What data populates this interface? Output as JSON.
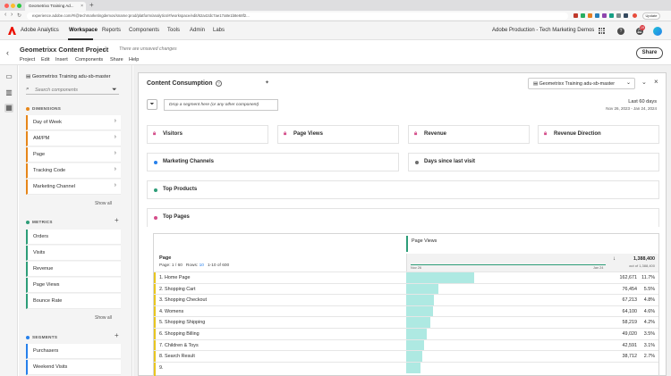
{
  "browser": {
    "tab_title": "Geometrixx Training Ad...",
    "url": "experience.adobe.com/#/@techmarketingdemos/sname:prod/platform/analytics/#/workspace/edit/62a42dc7ae17a8e1b8e68f2...",
    "update_label": "Update"
  },
  "appnav": {
    "app_name": "Adobe Analytics",
    "items": [
      "Workspace",
      "Reports",
      "Components",
      "Tools",
      "Admin",
      "Labs"
    ],
    "org_name": "Adobe Production - Tech Marketing Demos",
    "notification_count": "19"
  },
  "project": {
    "title": "Geometrixx Content Project",
    "unsaved": "There are unsaved changes",
    "menu": [
      "Project",
      "Edit",
      "Insert",
      "Components",
      "Share",
      "Help"
    ],
    "share_label": "Share"
  },
  "panel": {
    "report_suite": "Geometrixx Training adu-sb-master",
    "search_placeholder": "Search components",
    "dimensions_header": "DIMENSIONS",
    "dimensions": [
      "Day of Week",
      "AM/PM",
      "Page",
      "Tracking Code",
      "Marketing Channel"
    ],
    "metrics_header": "METRICS",
    "metrics": [
      "Orders",
      "Visits",
      "Revenue",
      "Page Views",
      "Bounce Rate"
    ],
    "segments_header": "SEGMENTS",
    "segments": [
      "Purchasers",
      "Weekend Visits"
    ],
    "show_all": "Show all"
  },
  "workspace": {
    "panel_title": "Content Consumption",
    "report_suite": "Geometrixx Training adu-sb-master",
    "drop_zone": "Drop a segment here (or any other component)",
    "date_title": "Last 60 days",
    "date_range": "Nov 26, 2023 - Jan 24, 2024",
    "cards_row1": [
      "Visitors",
      "Page Views",
      "Revenue",
      "Revenue Direction"
    ],
    "cards_row2": [
      "Marketing Channels",
      "Days since last visit"
    ],
    "sections": [
      "Top Products",
      "Top Pages"
    ]
  },
  "table": {
    "dimension": "Page",
    "pager_prefix": "Page:",
    "page": "1",
    "page_total": "/ 60",
    "rows_label": "Rows:",
    "rows_count": "10",
    "rows_range": "1-10 of 600",
    "metric": "Page Views",
    "total": "1,388,400",
    "total_sub": "out of 1,388,400",
    "spark_start": "Nov 26",
    "spark_end": "Jan 24",
    "rows": [
      {
        "label": "1.  Home Page",
        "value": "162,671",
        "pct": "11.7%",
        "share": 0.117
      },
      {
        "label": "2.  Shopping Cart",
        "value": "76,454",
        "pct": "5.5%",
        "share": 0.055
      },
      {
        "label": "3.  Shopping Checkout",
        "value": "67,213",
        "pct": "4.8%",
        "share": 0.048
      },
      {
        "label": "4.  Womens",
        "value": "64,100",
        "pct": "4.6%",
        "share": 0.046
      },
      {
        "label": "5.  Shopping Shipping",
        "value": "58,219",
        "pct": "4.2%",
        "share": 0.042
      },
      {
        "label": "6.  Shopping Billing",
        "value": "49,020",
        "pct": "3.5%",
        "share": 0.035
      },
      {
        "label": "7.  Children & Toys",
        "value": "42,591",
        "pct": "3.1%",
        "share": 0.031
      },
      {
        "label": "8.  Search Result",
        "value": "38,712",
        "pct": "2.7%",
        "share": 0.027
      },
      {
        "label": "9.",
        "value": "",
        "pct": "",
        "share": 0.025
      }
    ]
  },
  "colors": {
    "dimension": "#e68619",
    "metric": "#2d9d78",
    "segment": "#2680eb",
    "bar": "#aee9e2",
    "adobe_red": "#eb1000"
  },
  "icons": [
    "search-icon",
    "funnel-icon",
    "star-icon",
    "help-icon",
    "close-icon",
    "chevron-down-icon",
    "grid-icon",
    "bell-icon",
    "lock-icon"
  ]
}
